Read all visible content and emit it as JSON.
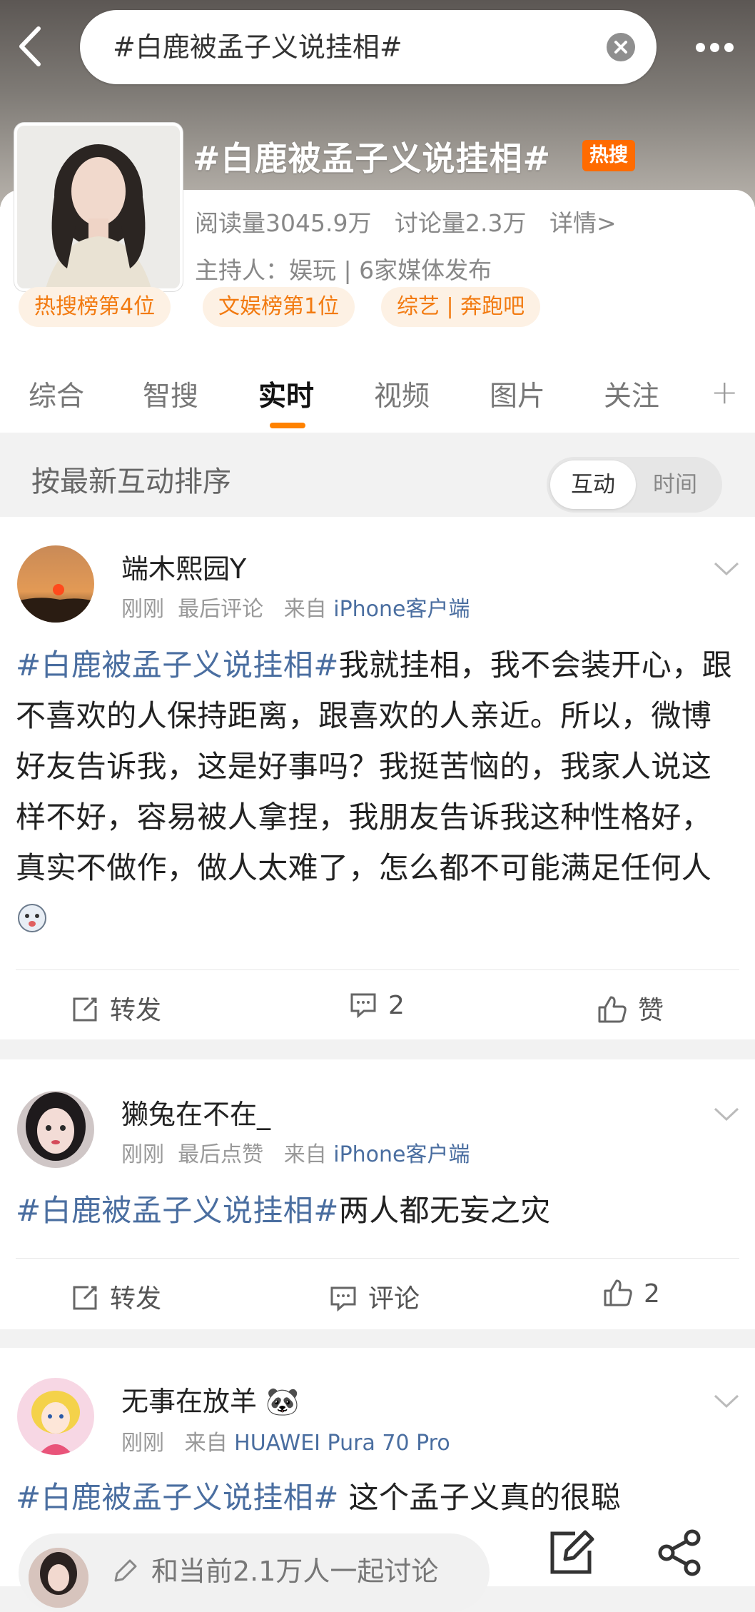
{
  "search": {
    "query": "#白鹿被孟子义说挂相#"
  },
  "topic": {
    "title": "#白鹿被孟子义说挂相#",
    "badge": "热搜",
    "reads": "阅读量3045.9万",
    "discussions": "讨论量2.3万",
    "details": "详情>",
    "host": "主持人：娱玩 | 6家媒体发布",
    "chips": [
      "热搜榜第4位",
      "文娱榜第1位",
      "综艺 | 奔跑吧"
    ]
  },
  "tabs": [
    "综合",
    "智搜",
    "实时",
    "视频",
    "图片",
    "关注"
  ],
  "active_tab": "实时",
  "sort": {
    "label": "按最新互动排序",
    "option_active": "互动",
    "option_inactive": "时间"
  },
  "posts": [
    {
      "username": "端木熙园Y",
      "time": "刚刚",
      "activity": "最后评论",
      "source_prefix": "来自",
      "source": "iPhone客户端",
      "tag": "#白鹿被孟子义说挂相#",
      "text": "我就挂相，我不会装开心，跟不喜欢的人保持距离，跟喜欢的人亲近。所以，微博好友告诉我，这是好事吗？我挺苦恼的，我家人说这样不好，容易被人拿捏，我朋友告诉我这种性格好，真实不做作，做人太难了，怎么都不可能满足任何人",
      "repost": "转发",
      "comment": "2",
      "like": "赞"
    },
    {
      "username": "獭兔在不在_",
      "time": "刚刚",
      "activity": "最后点赞",
      "source_prefix": "来自",
      "source": "iPhone客户端",
      "tag": "#白鹿被孟子义说挂相#",
      "text": "两人都无妄之灾",
      "repost": "转发",
      "comment": "评论",
      "like": "2"
    },
    {
      "username": "无事在放羊 🐼",
      "time": "刚刚",
      "source_prefix": "来自",
      "source": "HUAWEI Pura 70 Pro",
      "tag": "#白鹿被孟子义说挂相#",
      "text": " 这个孟子义真的很聪"
    }
  ],
  "compose": {
    "placeholder": "和当前2.1万人一起讨论"
  },
  "colors": {
    "accent": "#ff8200",
    "link": "#4a6ea0",
    "hot_badge": "#ff6b00"
  }
}
